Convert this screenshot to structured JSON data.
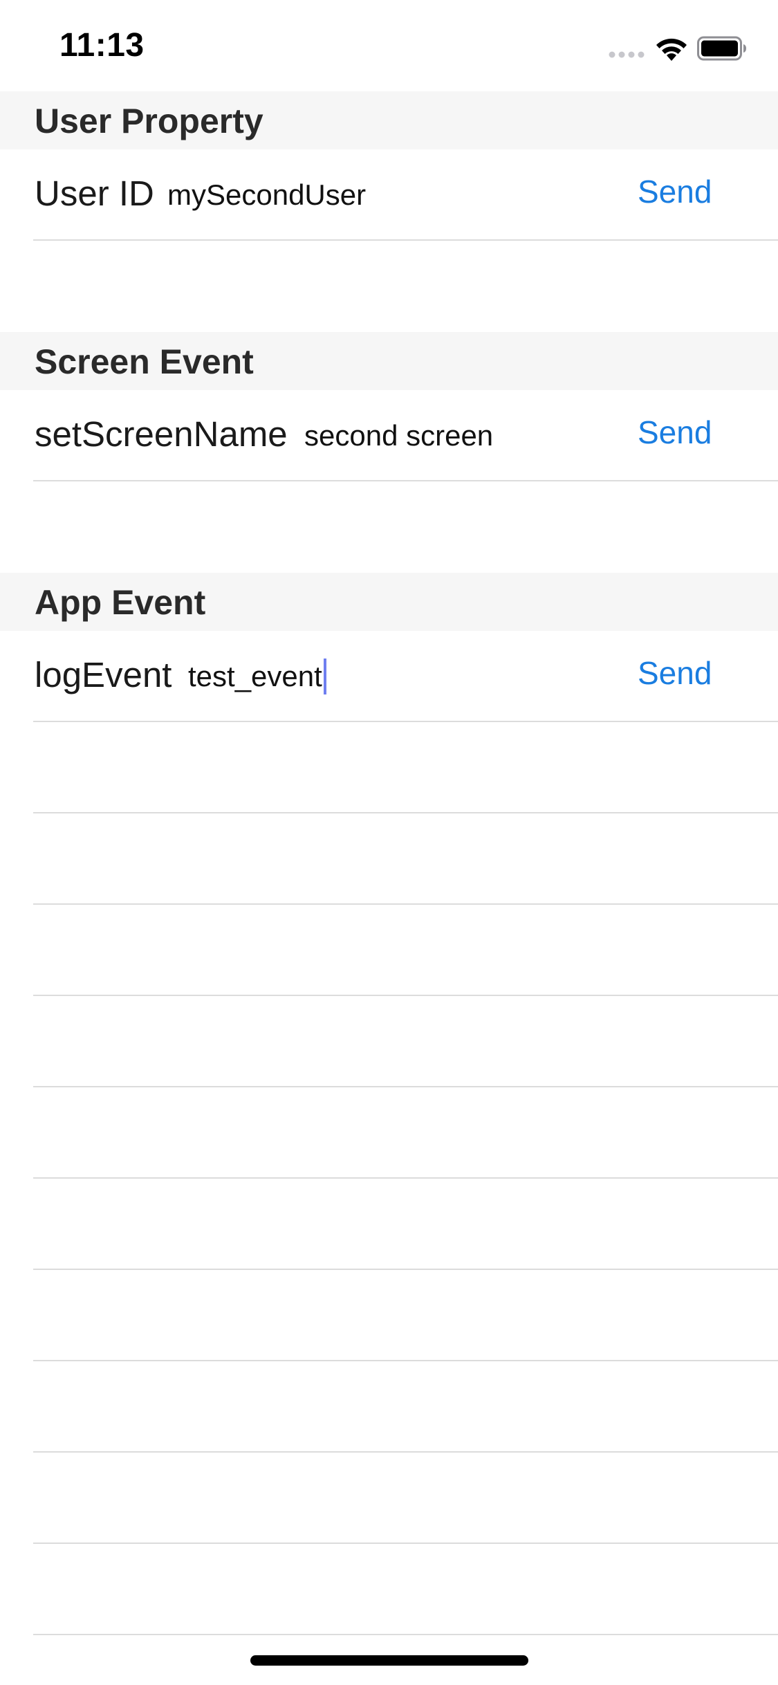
{
  "status_bar": {
    "time": "11:13",
    "icons": [
      "cellular-signal-icon",
      "wifi-icon",
      "battery-icon"
    ]
  },
  "sections": [
    {
      "title": "User Property",
      "row": {
        "label": "User ID",
        "input_value": "mySecondUser",
        "button_label": "Send"
      }
    },
    {
      "title": "Screen Event",
      "row": {
        "label": "setScreenName",
        "input_value": "second screen",
        "button_label": "Send"
      }
    },
    {
      "title": "App Event",
      "row": {
        "label": "logEvent",
        "input_value": "test_event",
        "button_label": "Send"
      }
    }
  ],
  "colors": {
    "accent": "#1a7de0",
    "section_background": "#f6f6f6",
    "separator": "#dcdcdc",
    "caret": "#6f7ff0"
  }
}
